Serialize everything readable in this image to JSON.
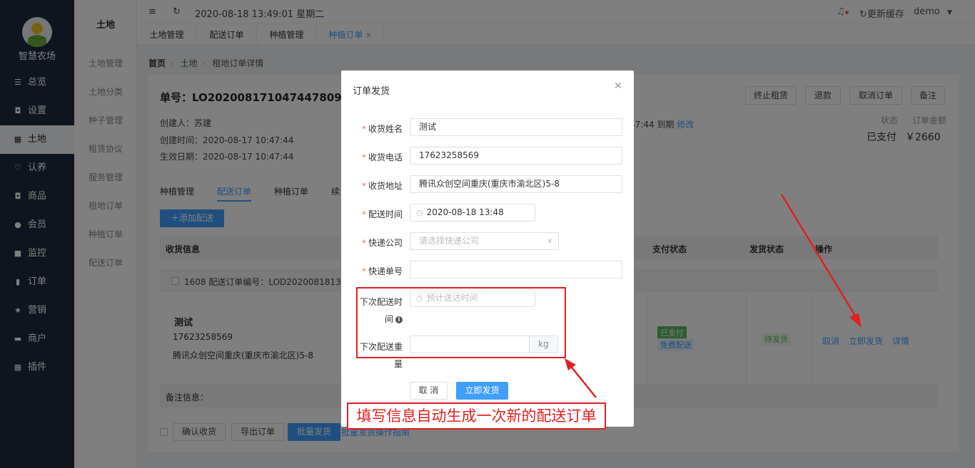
{
  "sidebar": {
    "logo_text": "智慧农场",
    "items": [
      {
        "icon": "sliders-icon",
        "glyph": "☰",
        "label": "总览"
      },
      {
        "icon": "bag-icon",
        "glyph": "◘",
        "label": "设置"
      },
      {
        "icon": "grid-icon",
        "glyph": "▦",
        "label": "土地"
      },
      {
        "icon": "badge-icon",
        "glyph": "♡",
        "label": "认养"
      },
      {
        "icon": "shopping-bag-icon",
        "glyph": "◘",
        "label": "商品"
      },
      {
        "icon": "user-icon",
        "glyph": "●",
        "label": "会员"
      },
      {
        "icon": "camera-icon",
        "glyph": "■",
        "label": "监控"
      },
      {
        "icon": "clipboard-icon",
        "glyph": "▮",
        "label": "订单"
      },
      {
        "icon": "star-icon",
        "glyph": "★",
        "label": "营销"
      },
      {
        "icon": "store-icon",
        "glyph": "▬",
        "label": "商户"
      },
      {
        "icon": "plugin-grid-icon",
        "glyph": "▦",
        "label": "插件"
      }
    ]
  },
  "subnav": {
    "title": "土地",
    "items": [
      "土地管理",
      "土地分类",
      "种子管理",
      "租赁协议",
      "服务管理",
      "租地订单",
      "种植订单",
      "配送订单"
    ]
  },
  "topbar": {
    "datetime": "2020-08-18 13:49:01 星期二",
    "refresh_cache": "更新缓存",
    "user": "demo"
  },
  "tabs": [
    "土地管理",
    "配送订单",
    "种植管理",
    "种植订单"
  ],
  "breadcrumb": [
    "首页",
    "土地",
    "租地订单详情"
  ],
  "order": {
    "title": "单号：LO2020081710474478092",
    "creator": "创建人：苏建",
    "created": "创建时间：2020-08-17 10:47:44",
    "effective": "生效日期：2020-08-17 10:47:44",
    "expire_fragment": ":47:44 到期",
    "modify": "修改",
    "buttons": [
      "终止租赁",
      "退款",
      "取消订单",
      "备注"
    ],
    "status_label": "状态",
    "amount_label": "订单金额",
    "status_value": "已支付",
    "amount_value": "￥2660"
  },
  "inner_tabs": [
    "种植管理",
    "配送订单",
    "种植订单",
    "续"
  ],
  "add_button": "添加配送",
  "table": {
    "headers": [
      "收货信息",
      "支付状态",
      "发货状态",
      "操作"
    ],
    "group": "1608 配送订单编号：LOD2020081813",
    "receiver_name": "测试",
    "receiver_phone": "17623258569",
    "receiver_address": "腾讯众创空间重庆(重庆市渝北区)5-8",
    "pay_status": "已支付",
    "delivery_mode": "免费配送",
    "ship_status": "待发货",
    "actions": [
      "取消",
      "立即发货",
      "详情"
    ],
    "remark": "备注信息："
  },
  "footer": {
    "buttons": [
      "确认收货",
      "导出订单",
      "批量发货"
    ],
    "guide": "批量发货操作指南"
  },
  "dialog": {
    "title": "订单发货",
    "fields": {
      "name_label": "收货姓名",
      "name_value": "测试",
      "phone_label": "收货电话",
      "phone_value": "17623258569",
      "address_label": "收货地址",
      "address_value": "腾讯众创空间重庆(重庆市渝北区)5-8",
      "time_label": "配送时间",
      "time_value": "2020-08-18 13:48",
      "courier_label": "快递公司",
      "courier_placeholder": "请选择快递公司",
      "tracking_label": "快递单号",
      "next_time_label_1": "下次配送时",
      "next_time_label_2": "间",
      "next_time_placeholder": "预计送达时间",
      "next_weight_label_1": "下次配送重",
      "next_weight_label_2": "量",
      "weight_unit": "kg"
    },
    "cancel": "取 消",
    "confirm": "立即发货"
  },
  "annotation": "填写信息自动生成一次新的配送订单",
  "colors": {
    "primary": "#409eff",
    "sidebar": "#1c2b3f",
    "annotation": "#e02020",
    "paid_badge": "#5bb85d"
  }
}
